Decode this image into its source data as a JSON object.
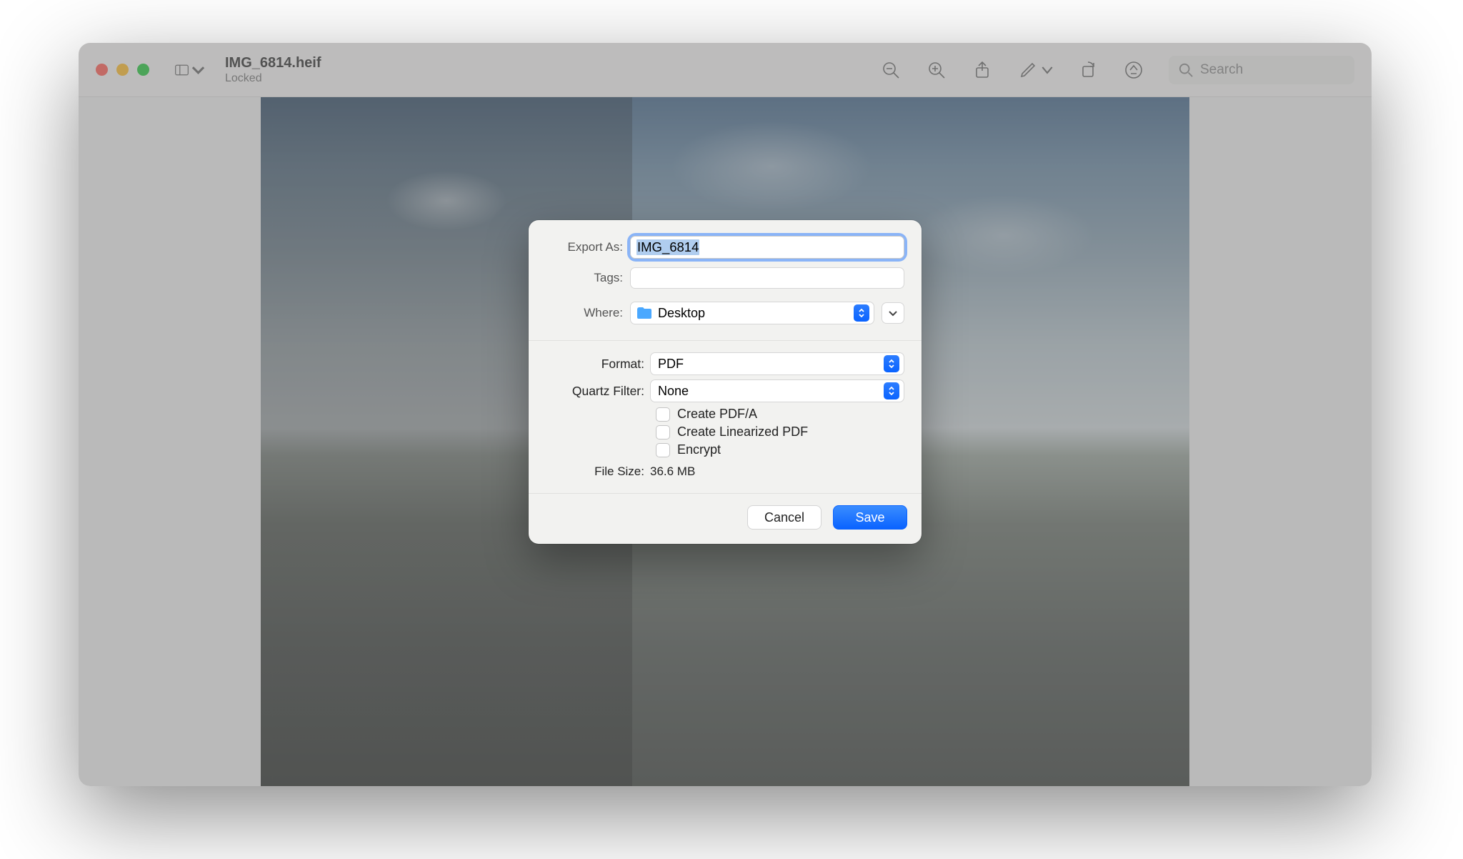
{
  "window": {
    "title": "IMG_6814.heif",
    "subtitle": "Locked"
  },
  "toolbar": {
    "search_placeholder": "Search"
  },
  "export": {
    "export_as_label": "Export As:",
    "filename": "IMG_6814",
    "tags_label": "Tags:",
    "tags_value": "",
    "where_label": "Where:",
    "where_value": "Desktop",
    "format_label": "Format:",
    "format_value": "PDF",
    "quartz_label": "Quartz Filter:",
    "quartz_value": "None",
    "opt_pdfa": "Create PDF/A",
    "opt_linear": "Create Linearized PDF",
    "opt_encrypt": "Encrypt",
    "file_size_label": "File Size:",
    "file_size_value": "36.6 MB",
    "cancel": "Cancel",
    "save": "Save"
  }
}
